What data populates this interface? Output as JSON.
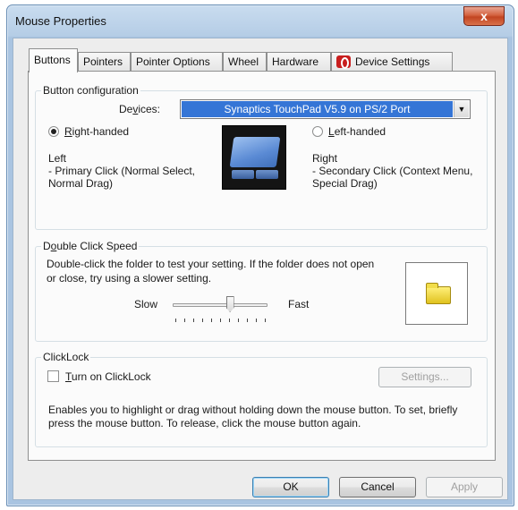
{
  "window": {
    "title": "Mouse Properties",
    "close_glyph": "x"
  },
  "tabs": [
    {
      "label": "Buttons"
    },
    {
      "label": "Pointers"
    },
    {
      "label": "Pointer Options"
    },
    {
      "label": "Wheel"
    },
    {
      "label": "Hardware"
    },
    {
      "label": "Device Settings",
      "icon": "synaptics-icon"
    }
  ],
  "button_configuration": {
    "group_label": "Button configuration",
    "devices_label_pre": "De",
    "devices_label_ul": "v",
    "devices_label_post": "ices:",
    "device_value": "Synaptics TouchPad V5.9 on PS/2 Port",
    "right_handed_ul": "R",
    "right_handed_rest": "ight-handed",
    "left_handed_ul": "L",
    "left_handed_rest": "eft-handed",
    "left_title": "Left",
    "left_desc": " - Primary Click (Normal Select, Normal Drag)",
    "right_title": "Right",
    "right_desc": " - Secondary Click (Context Menu, Special Drag)"
  },
  "double_click": {
    "group_label_pre": "D",
    "group_label_ul": "o",
    "group_label_post": "uble Click Speed",
    "instructions": "Double-click the folder to test your setting.  If the folder does not open or close, try using a slower setting.",
    "slow_label": "Slow",
    "fast_label": "Fast",
    "speed_fraction": 0.6
  },
  "clicklock": {
    "group_label": "ClickLock",
    "checkbox_ul": "T",
    "checkbox_rest": "urn on ClickLock",
    "settings_label": "Settings...",
    "description": "Enables you to highlight or drag without holding down the mouse button.  To set, briefly press the mouse button.  To release, click the mouse button again."
  },
  "footer": {
    "ok": "OK",
    "cancel": "Cancel",
    "apply": "Apply"
  }
}
